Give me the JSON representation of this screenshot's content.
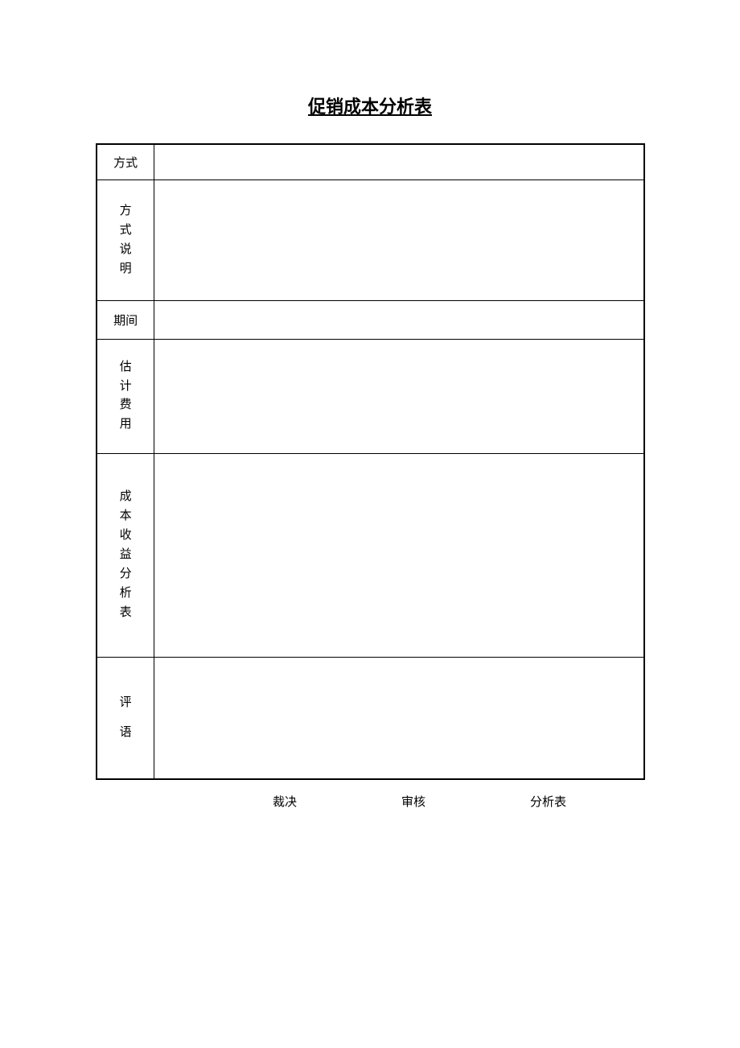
{
  "title": "促销成本分析表",
  "rows": {
    "r1_label": "方式",
    "r1_value": "",
    "r2_c1": "方",
    "r2_c2": "式",
    "r2_c3": "说",
    "r2_c4": "明",
    "r2_value": "",
    "r3_label": "期间",
    "r3_value": "",
    "r4_c1": "估",
    "r4_c2": "计",
    "r4_c3": "费",
    "r4_c4": "用",
    "r4_value": "",
    "r5_c1": "成",
    "r5_c2": "本",
    "r5_c3": "收",
    "r5_c4": "益",
    "r5_c5": "分",
    "r5_c6": "析",
    "r5_c7": "表",
    "r5_value": "",
    "r6_c1": "评",
    "r6_c2": "语",
    "r6_value": ""
  },
  "footer": {
    "f1": "裁决",
    "f2": "审核",
    "f3": "分析表"
  }
}
